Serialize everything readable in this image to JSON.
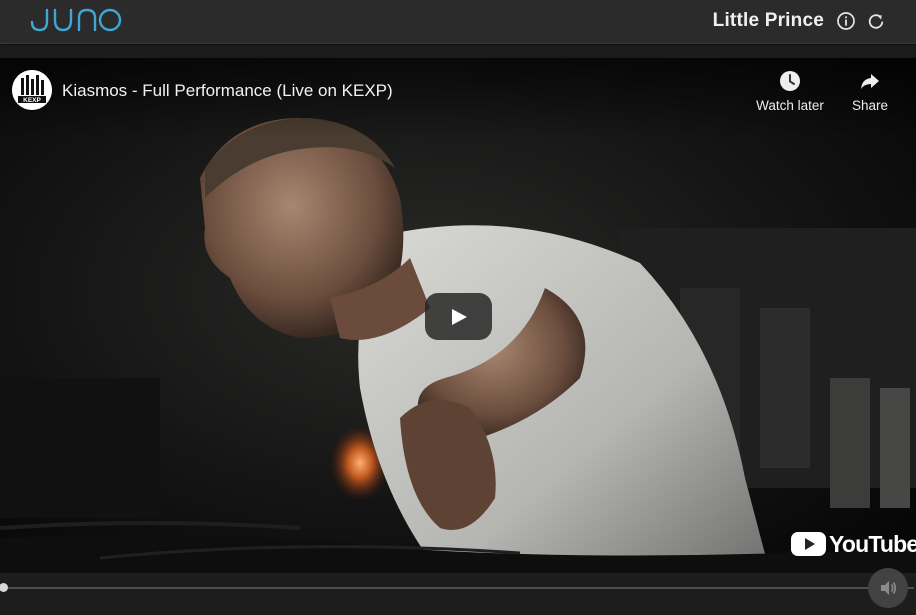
{
  "app": {
    "logo_text": "JUNO",
    "title": "Little Prince"
  },
  "video": {
    "channel_avatar_text": "KEXP",
    "title": "Kiasmos - Full Performance (Live on KEXP)",
    "watch_later_label": "Watch later",
    "share_label": "Share",
    "platform_logo_text": "YouTube",
    "progress_fraction": 0.0
  },
  "colors": {
    "logo_blue": "#3fa7d6",
    "youtube_red": "#ffffff",
    "topbar_bg": "#2b2b2b"
  }
}
